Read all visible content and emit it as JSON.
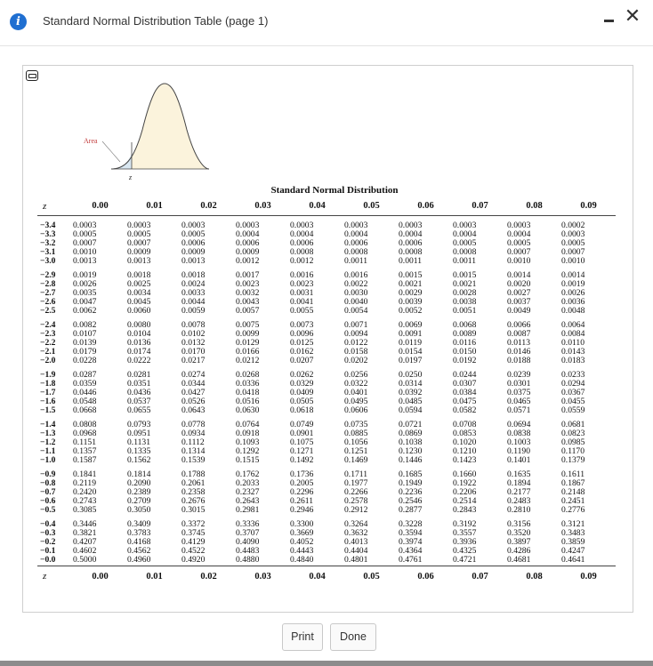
{
  "window": {
    "title": "Standard Normal Distribution Table (page 1)",
    "info_icon": "i",
    "close_icon": "✕"
  },
  "figure": {
    "area_label": "Area",
    "z_label": "z"
  },
  "table": {
    "title": "Standard Normal Distribution",
    "z_header": "z",
    "columns": [
      "0.00",
      "0.01",
      "0.02",
      "0.03",
      "0.04",
      "0.05",
      "0.06",
      "0.07",
      "0.08",
      "0.09"
    ],
    "groups": [
      {
        "z": [
          "−3.4",
          "−3.3",
          "−3.2",
          "−3.1",
          "−3.0"
        ],
        "values": [
          [
            "0.0003",
            "0.0003",
            "0.0003",
            "0.0003",
            "0.0003",
            "0.0003",
            "0.0003",
            "0.0003",
            "0.0003",
            "0.0002"
          ],
          [
            "0.0005",
            "0.0005",
            "0.0005",
            "0.0004",
            "0.0004",
            "0.0004",
            "0.0004",
            "0.0004",
            "0.0004",
            "0.0003"
          ],
          [
            "0.0007",
            "0.0007",
            "0.0006",
            "0.0006",
            "0.0006",
            "0.0006",
            "0.0006",
            "0.0005",
            "0.0005",
            "0.0005"
          ],
          [
            "0.0010",
            "0.0009",
            "0.0009",
            "0.0009",
            "0.0008",
            "0.0008",
            "0.0008",
            "0.0008",
            "0.0007",
            "0.0007"
          ],
          [
            "0.0013",
            "0.0013",
            "0.0013",
            "0.0012",
            "0.0012",
            "0.0011",
            "0.0011",
            "0.0011",
            "0.0010",
            "0.0010"
          ]
        ]
      },
      {
        "z": [
          "−2.9",
          "−2.8",
          "−2.7",
          "−2.6",
          "−2.5"
        ],
        "values": [
          [
            "0.0019",
            "0.0018",
            "0.0018",
            "0.0017",
            "0.0016",
            "0.0016",
            "0.0015",
            "0.0015",
            "0.0014",
            "0.0014"
          ],
          [
            "0.0026",
            "0.0025",
            "0.0024",
            "0.0023",
            "0.0023",
            "0.0022",
            "0.0021",
            "0.0021",
            "0.0020",
            "0.0019"
          ],
          [
            "0.0035",
            "0.0034",
            "0.0033",
            "0.0032",
            "0.0031",
            "0.0030",
            "0.0029",
            "0.0028",
            "0.0027",
            "0.0026"
          ],
          [
            "0.0047",
            "0.0045",
            "0.0044",
            "0.0043",
            "0.0041",
            "0.0040",
            "0.0039",
            "0.0038",
            "0.0037",
            "0.0036"
          ],
          [
            "0.0062",
            "0.0060",
            "0.0059",
            "0.0057",
            "0.0055",
            "0.0054",
            "0.0052",
            "0.0051",
            "0.0049",
            "0.0048"
          ]
        ]
      },
      {
        "z": [
          "−2.4",
          "−2.3",
          "−2.2",
          "−2.1",
          "−2.0"
        ],
        "values": [
          [
            "0.0082",
            "0.0080",
            "0.0078",
            "0.0075",
            "0.0073",
            "0.0071",
            "0.0069",
            "0.0068",
            "0.0066",
            "0.0064"
          ],
          [
            "0.0107",
            "0.0104",
            "0.0102",
            "0.0099",
            "0.0096",
            "0.0094",
            "0.0091",
            "0.0089",
            "0.0087",
            "0.0084"
          ],
          [
            "0.0139",
            "0.0136",
            "0.0132",
            "0.0129",
            "0.0125",
            "0.0122",
            "0.0119",
            "0.0116",
            "0.0113",
            "0.0110"
          ],
          [
            "0.0179",
            "0.0174",
            "0.0170",
            "0.0166",
            "0.0162",
            "0.0158",
            "0.0154",
            "0.0150",
            "0.0146",
            "0.0143"
          ],
          [
            "0.0228",
            "0.0222",
            "0.0217",
            "0.0212",
            "0.0207",
            "0.0202",
            "0.0197",
            "0.0192",
            "0.0188",
            "0.0183"
          ]
        ]
      },
      {
        "z": [
          "−1.9",
          "−1.8",
          "−1.7",
          "−1.6",
          "−1.5"
        ],
        "values": [
          [
            "0.0287",
            "0.0281",
            "0.0274",
            "0.0268",
            "0.0262",
            "0.0256",
            "0.0250",
            "0.0244",
            "0.0239",
            "0.0233"
          ],
          [
            "0.0359",
            "0.0351",
            "0.0344",
            "0.0336",
            "0.0329",
            "0.0322",
            "0.0314",
            "0.0307",
            "0.0301",
            "0.0294"
          ],
          [
            "0.0446",
            "0.0436",
            "0.0427",
            "0.0418",
            "0.0409",
            "0.0401",
            "0.0392",
            "0.0384",
            "0.0375",
            "0.0367"
          ],
          [
            "0.0548",
            "0.0537",
            "0.0526",
            "0.0516",
            "0.0505",
            "0.0495",
            "0.0485",
            "0.0475",
            "0.0465",
            "0.0455"
          ],
          [
            "0.0668",
            "0.0655",
            "0.0643",
            "0.0630",
            "0.0618",
            "0.0606",
            "0.0594",
            "0.0582",
            "0.0571",
            "0.0559"
          ]
        ]
      },
      {
        "z": [
          "−1.4",
          "−1.3",
          "−1.2",
          "−1.1",
          "−1.0"
        ],
        "values": [
          [
            "0.0808",
            "0.0793",
            "0.0778",
            "0.0764",
            "0.0749",
            "0.0735",
            "0.0721",
            "0.0708",
            "0.0694",
            "0.0681"
          ],
          [
            "0.0968",
            "0.0951",
            "0.0934",
            "0.0918",
            "0.0901",
            "0.0885",
            "0.0869",
            "0.0853",
            "0.0838",
            "0.0823"
          ],
          [
            "0.1151",
            "0.1131",
            "0.1112",
            "0.1093",
            "0.1075",
            "0.1056",
            "0.1038",
            "0.1020",
            "0.1003",
            "0.0985"
          ],
          [
            "0.1357",
            "0.1335",
            "0.1314",
            "0.1292",
            "0.1271",
            "0.1251",
            "0.1230",
            "0.1210",
            "0.1190",
            "0.1170"
          ],
          [
            "0.1587",
            "0.1562",
            "0.1539",
            "0.1515",
            "0.1492",
            "0.1469",
            "0.1446",
            "0.1423",
            "0.1401",
            "0.1379"
          ]
        ]
      },
      {
        "z": [
          "−0.9",
          "−0.8",
          "−0.7",
          "−0.6",
          "−0.5"
        ],
        "values": [
          [
            "0.1841",
            "0.1814",
            "0.1788",
            "0.1762",
            "0.1736",
            "0.1711",
            "0.1685",
            "0.1660",
            "0.1635",
            "0.1611"
          ],
          [
            "0.2119",
            "0.2090",
            "0.2061",
            "0.2033",
            "0.2005",
            "0.1977",
            "0.1949",
            "0.1922",
            "0.1894",
            "0.1867"
          ],
          [
            "0.2420",
            "0.2389",
            "0.2358",
            "0.2327",
            "0.2296",
            "0.2266",
            "0.2236",
            "0.2206",
            "0.2177",
            "0.2148"
          ],
          [
            "0.2743",
            "0.2709",
            "0.2676",
            "0.2643",
            "0.2611",
            "0.2578",
            "0.2546",
            "0.2514",
            "0.2483",
            "0.2451"
          ],
          [
            "0.3085",
            "0.3050",
            "0.3015",
            "0.2981",
            "0.2946",
            "0.2912",
            "0.2877",
            "0.2843",
            "0.2810",
            "0.2776"
          ]
        ]
      },
      {
        "z": [
          "−0.4",
          "−0.3",
          "−0.2",
          "−0.1",
          "−0.0"
        ],
        "values": [
          [
            "0.3446",
            "0.3409",
            "0.3372",
            "0.3336",
            "0.3300",
            "0.3264",
            "0.3228",
            "0.3192",
            "0.3156",
            "0.3121"
          ],
          [
            "0.3821",
            "0.3783",
            "0.3745",
            "0.3707",
            "0.3669",
            "0.3632",
            "0.3594",
            "0.3557",
            "0.3520",
            "0.3483"
          ],
          [
            "0.4207",
            "0.4168",
            "0.4129",
            "0.4090",
            "0.4052",
            "0.4013",
            "0.3974",
            "0.3936",
            "0.3897",
            "0.3859"
          ],
          [
            "0.4602",
            "0.4562",
            "0.4522",
            "0.4483",
            "0.4443",
            "0.4404",
            "0.4364",
            "0.4325",
            "0.4286",
            "0.4247"
          ],
          [
            "0.5000",
            "0.4960",
            "0.4920",
            "0.4880",
            "0.4840",
            "0.4801",
            "0.4761",
            "0.4721",
            "0.4681",
            "0.4641"
          ]
        ]
      }
    ]
  },
  "buttons": {
    "print": "Print",
    "done": "Done"
  },
  "colors": {
    "info_icon": "#1f6fd1",
    "curve_fill": "#fbf3dc",
    "area_fill": "#d9e7f1",
    "curve_stroke": "#444444"
  }
}
